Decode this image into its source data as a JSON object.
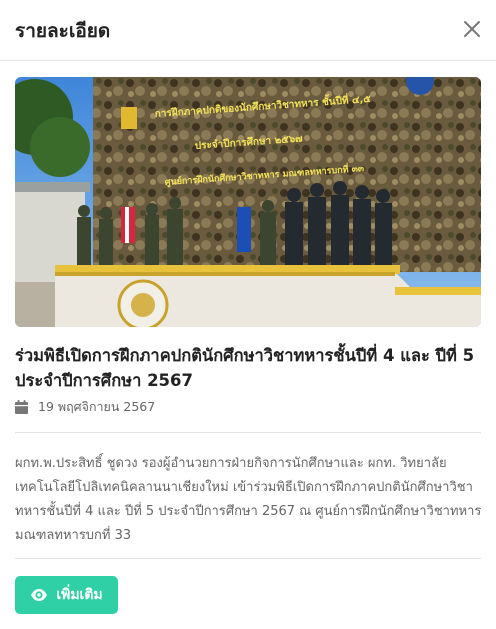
{
  "modal": {
    "title": "รายละเอียด",
    "close_icon": "close-icon"
  },
  "photo": {
    "banner_text": [
      "การฝึกภาคปกติของนักศึกษาวิชาทหาร ชั้นปีที่ ๔,๕",
      "ประจำปีการศึกษา ๒๕๖๗",
      "ศูนย์การฝึกนักศึกษาวิชาทหาร มณฑลทหารบกที่ ๓๓"
    ]
  },
  "article": {
    "title": "ร่วมพิธีเปิดการฝึกภาคปกตินักศึกษาวิชาทหารชั้นปีที่ 4 และ ปีที่ 5 ประจำปีการศึกษา 2567",
    "date_icon": "calendar-icon",
    "date": "19 พฤศจิกายน 2567",
    "description": "ผกท.พ.ประสิทธิ์ ชูดวง รองผู้อำนวยการฝ่ายกิจการนักศึกษาและ ผกท. วิทยาลัยเทคโนโลยีโปลิเทคนิคลานนาเชียงใหม่ เข้าร่วมพิธีเปิดการฝึกภาคปกตินักศึกษาวิชาทหารชั้นปีที่ 4 และ ปีที่ 5 ประจำปีการศึกษา 2567 ณ ศูนย์การฝึกนักศึกษาวิชาทหารมณฑลทหารบกที่ 33"
  },
  "actions": {
    "more_label": "เพิ่มเติม",
    "more_icon": "eye-icon",
    "accent": "#2fd0a5"
  }
}
